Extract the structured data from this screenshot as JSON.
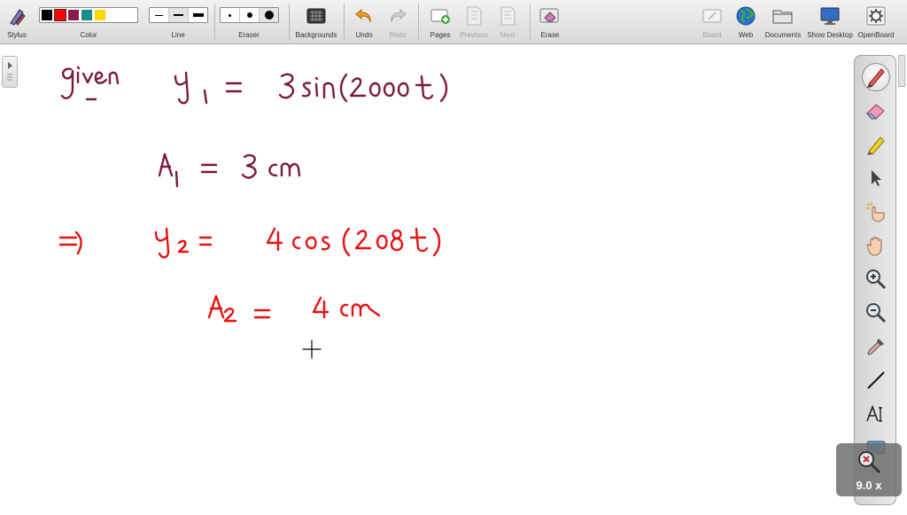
{
  "toolbar": {
    "stylus_label": "Stylus",
    "color_label": "Color",
    "line_label": "Line",
    "eraser_label": "Eraser",
    "backgrounds_label": "Backgrounds",
    "undo_label": "Undo",
    "redo_label": "Redo",
    "pages_label": "Pages",
    "previous_label": "Previous",
    "next_label": "Next",
    "erase_label": "Erase",
    "board_label": "Board",
    "web_label": "Web",
    "documents_label": "Documents",
    "show_desktop_label": "Show Desktop",
    "openboard_label": "OpenBoard",
    "colors": [
      "#000000",
      "#ff0000",
      "#8b1a4b",
      "#1a8a8a",
      "#ffd800"
    ]
  },
  "palette": {
    "tools": [
      "pen-icon",
      "eraser-icon",
      "highlighter-icon",
      "pointer-icon",
      "laser-pointer-icon",
      "hand-icon",
      "zoom-in-icon",
      "zoom-out-icon",
      "eyedropper-icon",
      "line-icon",
      "text-icon",
      "capture-icon"
    ],
    "zoom_level": "9.0 x"
  },
  "board": {
    "ink_dark": "#7a1a40",
    "ink_red": "#e81010",
    "lines": [
      "given",
      "y1 = 3sin(2000t)",
      "A1 = 3 cm",
      "⇒",
      "y2 = 4cos(208t)",
      "A2 = 4cm"
    ]
  }
}
